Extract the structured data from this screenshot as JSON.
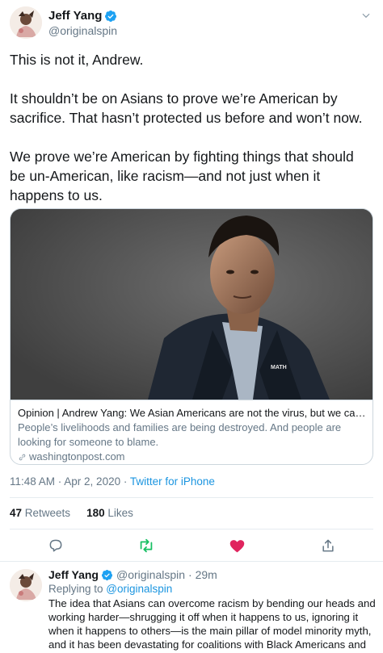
{
  "tweet": {
    "author_name": "Jeff Yang",
    "author_handle": "@originalspin",
    "paragraphs": [
      "This is not it, Andrew.",
      "It shouldn’t be on Asians to prove we’re American by sacrifice. That hasn’t protected us before and won’t now.",
      "We prove we’re American by fighting things that should be un-American, like racism—and not just when it happens to us."
    ],
    "card": {
      "title": "Opinion | Andrew Yang: We Asian Americans are not the virus, but we can be …",
      "description": "People’s livelihoods and families are being destroyed. And people are looking for someone to blame.",
      "domain": "washingtonpost.com",
      "shirt_text": "MATH"
    },
    "timestamp": "11:48 AM · Apr 2, 2020 · ",
    "source": "Twitter for iPhone",
    "retweets_count": "47",
    "retweets_label": " Retweets",
    "likes_count": "180",
    "likes_label": " Likes"
  },
  "reply": {
    "author_name": "Jeff Yang",
    "author_handle": "@originalspin",
    "time": "· 29m",
    "replying_to_label": "Replying to ",
    "replying_to_handle": "@originalspin",
    "text": "The idea that Asians can overcome racism by bending our heads and working harder—shrugging it off when it happens to us, ignoring it when it happens to others—is the main pillar of model minority myth, and it has been devastating for coalitions with Black Americans and other POC."
  },
  "icons": {
    "verified": "verified-badge-icon",
    "caret": "chevron-down-icon",
    "reply": "reply-icon",
    "retweet": "retweet-icon",
    "like": "heart-icon",
    "share": "share-icon",
    "link": "link-icon"
  },
  "colors": {
    "twitter_blue": "#1da1f2",
    "link_blue": "#1b95e0",
    "retweet_green": "#17bf63",
    "like_red": "#e0245e",
    "secondary_text": "#657786"
  }
}
